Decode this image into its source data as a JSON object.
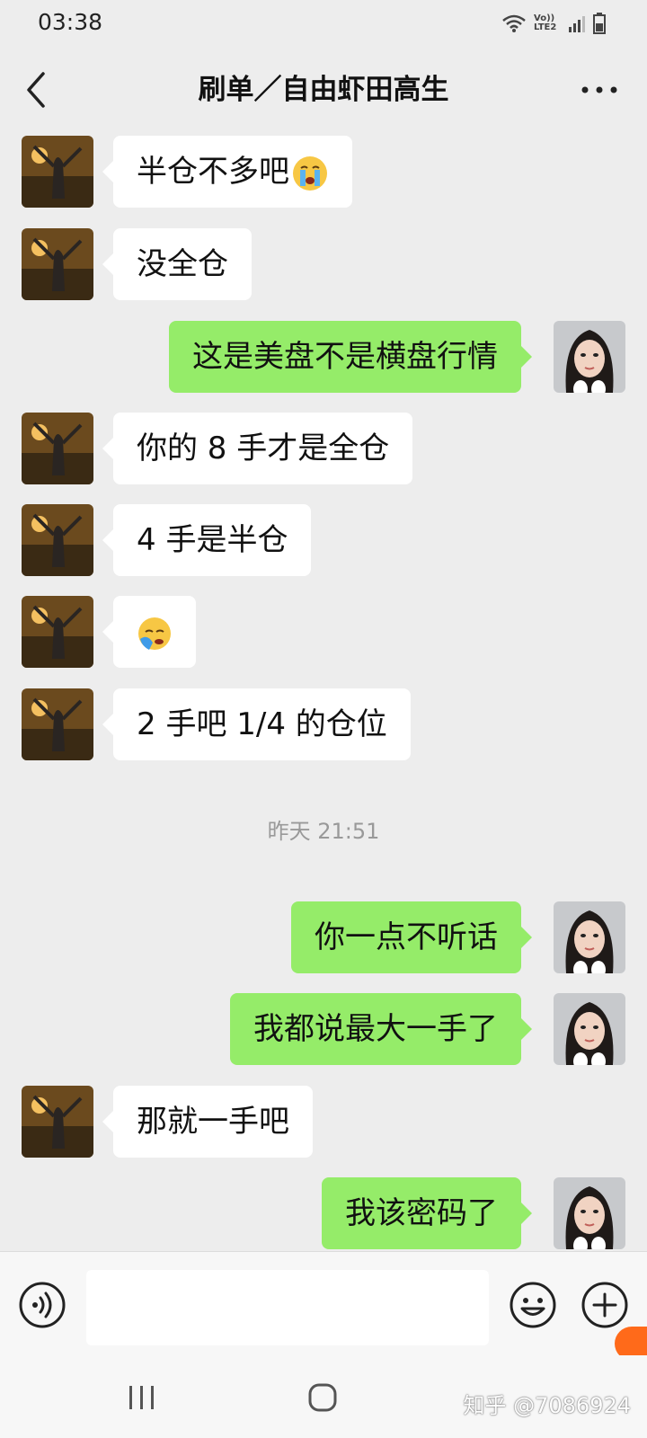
{
  "status_bar": {
    "time": "03:38",
    "volte_label": "Vo)) LTE2"
  },
  "header": {
    "title": "刷单／自由虾田高生"
  },
  "messages": [
    {
      "side": "in",
      "text": "半仓不多吧",
      "emoji": "crying-face"
    },
    {
      "side": "in",
      "text": "没全仓"
    },
    {
      "side": "out",
      "text": "这是美盘不是横盘行情"
    },
    {
      "side": "in",
      "text": "你的 8 手才是全仓"
    },
    {
      "side": "in",
      "text": "4 手是半仓"
    },
    {
      "side": "in",
      "text": "",
      "emoji": "facepalm-face"
    },
    {
      "side": "in",
      "text": "2 手吧 1/4 的仓位"
    },
    {
      "timestamp": "昨天 21:51"
    },
    {
      "side": "out",
      "text": "你一点不听话"
    },
    {
      "side": "out",
      "text": "我都说最大一手了"
    },
    {
      "side": "in",
      "text": "那就一手吧"
    },
    {
      "side": "out",
      "text": "我该密码了"
    }
  ],
  "input": {
    "value": ""
  },
  "watermark": "知乎 @7086924",
  "colors": {
    "outgoing_bubble": "#95ec69",
    "incoming_bubble": "#ffffff",
    "background": "#ededed"
  }
}
